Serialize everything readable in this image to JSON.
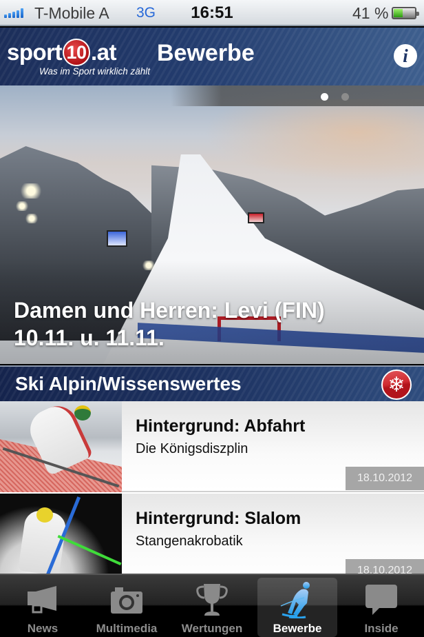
{
  "status_bar": {
    "carrier": "T-Mobile A",
    "network": "3G",
    "time": "16:51",
    "battery_percent_label": "41 %",
    "battery_level": 0.41,
    "signal_bars": 5
  },
  "nav": {
    "logo_text_left": "sport",
    "logo_number": "10",
    "logo_text_right": ".at",
    "logo_tagline": "Was im Sport wirklich zählt",
    "title": "Bewerbe",
    "info_icon": "i"
  },
  "hero": {
    "caption_line1": "Damen und Herren: Levi (FIN)",
    "caption_line2": "10.11. u. 11.11.",
    "pager": {
      "count": 2,
      "active_index": 0
    }
  },
  "section": {
    "title": "Ski Alpin/Wissenswertes",
    "icon": "snowflake-icon",
    "icon_glyph": "❄"
  },
  "articles": [
    {
      "title": "Hintergrund: Abfahrt",
      "subtitle": "Die Königsdiszplin",
      "date": "18.10.2012"
    },
    {
      "title": "Hintergrund: Slalom",
      "subtitle": "Stangenakrobatik",
      "date": "18.10.2012"
    }
  ],
  "tabbar": {
    "tabs": [
      {
        "label": "News",
        "icon": "megaphone-icon",
        "active": false
      },
      {
        "label": "Multimedia",
        "icon": "camera-icon",
        "active": false
      },
      {
        "label": "Wertungen",
        "icon": "trophy-icon",
        "active": false
      },
      {
        "label": "Bewerbe",
        "icon": "skier-icon",
        "active": true
      },
      {
        "label": "Inside",
        "icon": "speech-bubble-icon",
        "active": false
      }
    ]
  },
  "colors": {
    "nav_blue": "#1c2e5a",
    "brand_red": "#b01217",
    "network_blue": "#2668d8",
    "active_tab_icon": "#3fa9f0",
    "date_badge_bg": "#a6a6a6"
  }
}
